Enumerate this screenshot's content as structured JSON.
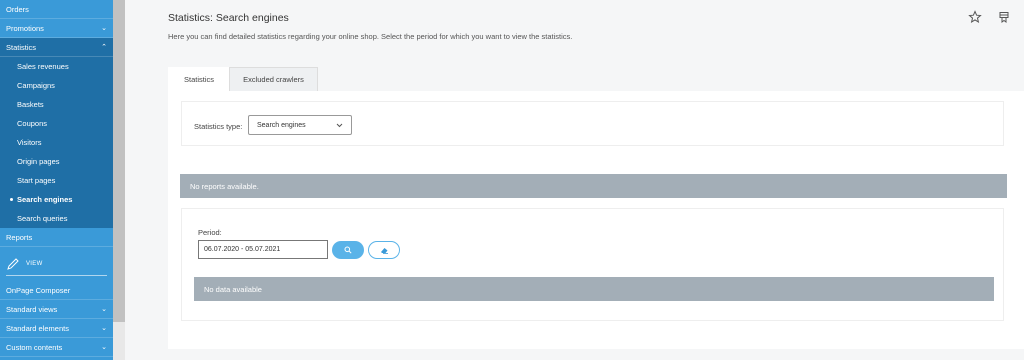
{
  "sidebar": {
    "top_items": [
      {
        "label": "Orders",
        "chevron": ""
      },
      {
        "label": "Promotions",
        "chevron": "⌄"
      },
      {
        "label": "Statistics",
        "chevron": "⌃"
      }
    ],
    "sub_items": [
      {
        "label": "Sales revenues",
        "active": false
      },
      {
        "label": "Campaigns",
        "active": false
      },
      {
        "label": "Baskets",
        "active": false
      },
      {
        "label": "Coupons",
        "active": false
      },
      {
        "label": "Visitors",
        "active": false
      },
      {
        "label": "Origin pages",
        "active": false
      },
      {
        "label": "Start pages",
        "active": false
      },
      {
        "label": "Search engines",
        "active": true
      },
      {
        "label": "Search queries",
        "active": false
      }
    ],
    "reports_label": "Reports",
    "view_label": "VIEW",
    "bottom_items": [
      {
        "label": "OnPage Composer",
        "chevron": ""
      },
      {
        "label": "Standard views",
        "chevron": "⌄"
      },
      {
        "label": "Standard elements",
        "chevron": "⌄"
      },
      {
        "label": "Custom contents",
        "chevron": "⌄"
      }
    ]
  },
  "header": {
    "title": "Statistics: Search engines",
    "description": "Here you can find detailed statistics regarding your online shop. Select the period for which you want to view the statistics.",
    "icons": [
      "star-icon",
      "bookmark-icon"
    ]
  },
  "tabs": [
    {
      "label": "Statistics",
      "active": true
    },
    {
      "label": "Excluded crawlers",
      "active": false
    }
  ],
  "filter": {
    "type_label": "Statistics type:",
    "type_value": "Search engines"
  },
  "reports_message": "No reports available.",
  "period": {
    "label": "Period:",
    "value": "06.07.2020 - 05.07.2021"
  },
  "no_data_message": "No data available",
  "colors": {
    "sidebar": "#3a9ad8",
    "sidebar_sub": "#1f6fa6",
    "accent": "#5ab3e8",
    "message_bar": "#a3aeb7"
  }
}
